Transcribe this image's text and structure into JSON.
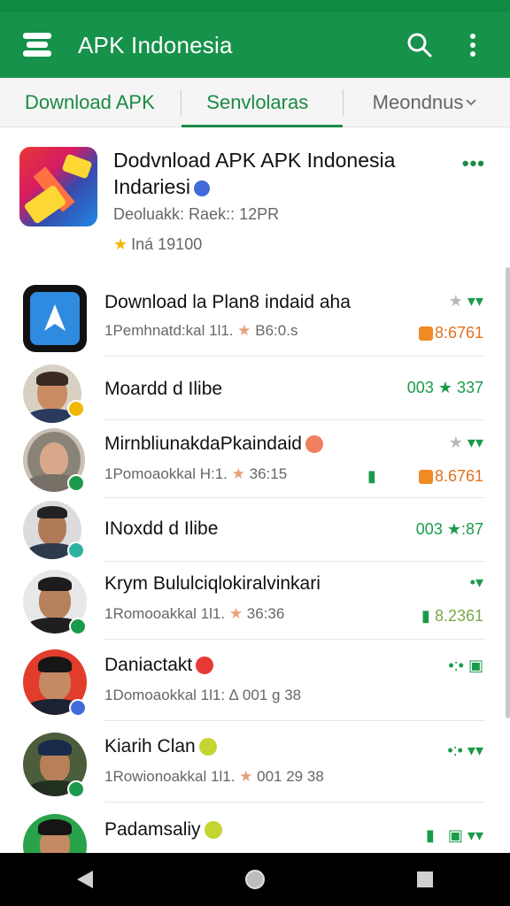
{
  "app": {
    "title": "APK Indonesia",
    "colors": {
      "primary": "#16924a",
      "accent": "#1b8a45",
      "star": "#f5b400",
      "orange": "#e2711d"
    }
  },
  "toolbar": {
    "logo_icon": "stack-logo-icon",
    "search_icon": "search-icon",
    "menu_icon": "more-vert-icon"
  },
  "tabs": [
    {
      "label": "Download APK",
      "selected": false
    },
    {
      "label": "Senvlolaras",
      "selected": true
    },
    {
      "label": "Meondnus",
      "selected": false,
      "dropdown": true
    }
  ],
  "featured": {
    "title": "Dodvnload APK APK Indonesia",
    "title2": "Indariesi",
    "subtitle": "Deoluakk: Raek:: 12PR",
    "rating": "Iná 19100",
    "more": "•••"
  },
  "rows": [
    {
      "title": "Download la Plan8 indaid aha",
      "subtitle": "1Pemhnatd:kal 1l1.",
      "subtitle_rating": "B6:0.s",
      "right_top": "★ ▾▾",
      "right_bottom": "8:6761"
    },
    {
      "title": "Moardd d Ilibe",
      "subtitle": "",
      "right_top": "003 ★ 337",
      "right_bottom": ""
    },
    {
      "title": "MirnbliunakdaPkaindaid",
      "subtitle": "1Pomoaokkal H:1.",
      "subtitle_rating": "36:15",
      "right_top": "★ ▾▾",
      "right_bottom": "8.6761"
    },
    {
      "title": "INoxdd d Ilibe",
      "subtitle": "",
      "right_top": "003 ★:87",
      "right_bottom": ""
    },
    {
      "title": "Krym Bululciqlokiralvinkari",
      "subtitle": "1Romooakkal 1l1.",
      "subtitle_rating": "36:36",
      "right_top": "•▾",
      "right_bottom": "8.2361"
    },
    {
      "title": "Daniactakt",
      "subtitle": "1Domoaokkal 1l1:",
      "subtitle_rating": "∆ 001 g 38",
      "right_top": "•:• ▣",
      "right_bottom": ""
    },
    {
      "title": "Kiarih Clan",
      "subtitle": "1Rowionoakkal 1l1.",
      "subtitle_rating": "001 29 38",
      "right_top": "•:• ▾▾",
      "right_bottom": ""
    },
    {
      "title": "Padamsaliy",
      "subtitle": "",
      "right_top": "▾▾",
      "right_bottom": ""
    }
  ],
  "nav": {
    "back_icon": "back-triangle-icon",
    "home_icon": "home-circle-icon",
    "recents_icon": "recents-square-icon"
  }
}
